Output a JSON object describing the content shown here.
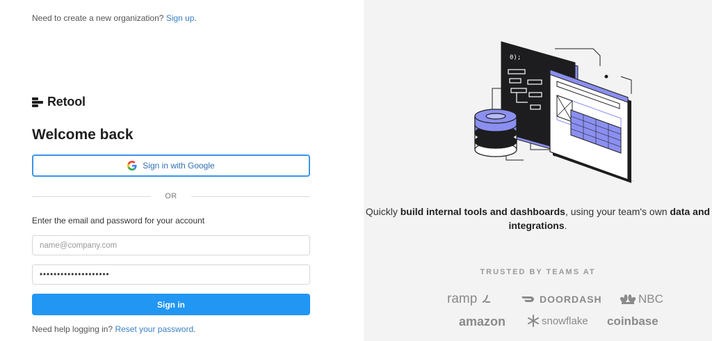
{
  "header": {
    "prompt": "Need to create a new organization?",
    "signup_link": "Sign up",
    "signup_suffix": "."
  },
  "brand": {
    "name": "Retool"
  },
  "login": {
    "title": "Welcome back",
    "google_button": "Sign in with Google",
    "divider": "OR",
    "instructions": "Enter the email and password for your account",
    "email_placeholder": "name@company.com",
    "email_value": "",
    "password_value": "••••••••••••••••••••",
    "submit": "Sign in",
    "help_prompt": "Need help logging in?",
    "reset_link": "Reset your password",
    "reset_suffix": "."
  },
  "marketing": {
    "tagline_prefix": "Quickly ",
    "tagline_bold_1": "build internal tools and dashboards",
    "tagline_mid": ", using your team's own ",
    "tagline_bold_2": "data and integrations",
    "tagline_suffix": ".",
    "trusted_heading": "TRUSTED BY TEAMS AT",
    "logos": [
      "ramp",
      "DOORDASH",
      "NBC",
      "amazon",
      "snowflake",
      "coinbase"
    ]
  },
  "colors": {
    "accent": "#2196f3",
    "link": "#3b82c4",
    "panel_bg": "#f3f3f3",
    "illustration_accent": "#8b8ff0"
  },
  "icons": {
    "google": "google-icon",
    "logo": "retool-logo-icon"
  }
}
